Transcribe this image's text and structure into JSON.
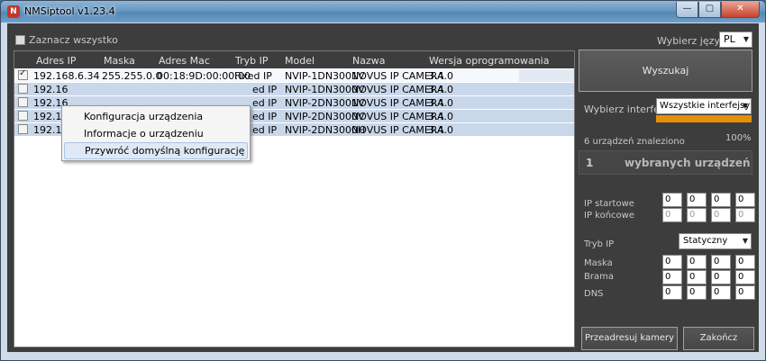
{
  "window": {
    "title": "NMSiptool v1.23.4",
    "controls": {
      "minimize": "—",
      "maximize": "▢",
      "close": "✕"
    }
  },
  "toolbar": {
    "select_all_label": "Zaznacz wszystko"
  },
  "table": {
    "columns": [
      "Adres IP",
      "Maska",
      "Adres Mac",
      "Tryb IP",
      "Model",
      "Nazwa",
      "Wersja oprogramowania"
    ],
    "rows": [
      {
        "checked": true,
        "ip": "192.168.6.34",
        "mask": "255.255.0.0",
        "mac": "00:18:9D:00:00:00",
        "mode": "Fixed IP",
        "model": "NVIP-1DN3001V",
        "name": "NOVUS IP CAMERA",
        "version": "3.4.0"
      },
      {
        "checked": false,
        "ip": "192.16",
        "mask": "",
        "mac": "",
        "mode": "ed IP",
        "model": "NVIP-1DN3000V",
        "name": "NOVUS IP CAMERA",
        "version": "3.4.0"
      },
      {
        "checked": false,
        "ip": "192.16",
        "mask": "",
        "mac": "",
        "mode": "ed IP",
        "model": "NVIP-2DN3001V",
        "name": "NOVUS IP CAMERA",
        "version": "3.4.0"
      },
      {
        "checked": false,
        "ip": "192.16",
        "mask": "",
        "mac": "",
        "mode": "ed IP",
        "model": "NVIP-2DN3000V",
        "name": "NOVUS IP CAMERA",
        "version": "3.4.0"
      },
      {
        "checked": false,
        "ip": "192.16",
        "mask": "",
        "mac": "",
        "mode": "ed IP",
        "model": "NVIP-2DN3000H",
        "name": "NOVUS IP CAMERA",
        "version": "3.4.0"
      }
    ]
  },
  "context_menu": {
    "items": [
      "Konfiguracja urządzenia",
      "Informacje o urządzeniu",
      "Przywróć domyślną konfigurację"
    ]
  },
  "panel": {
    "language_label": "Wybierz język",
    "language_value": "PL",
    "search_button": "Wyszukaj",
    "interface_label": "Wybierz interfejs",
    "interface_value": "Wszystkie interfejsy",
    "progress_percent": 100,
    "found_text": "6 urządzeń znaleziono",
    "percent_text": "100%",
    "selected_count": "1",
    "selected_label": "wybranych urządzeń",
    "ip_start_label": "IP startowe",
    "ip_end_label": "IP końcowe",
    "ip_start": [
      "0",
      "0",
      "0",
      "0"
    ],
    "ip_end": [
      "0",
      "0",
      "0",
      "0"
    ],
    "mode_label": "Tryb IP",
    "mode_value": "Statyczny",
    "mask_label": "Maska",
    "gateway_label": "Brama",
    "dns_label": "DNS",
    "mask": [
      "0",
      "0",
      "0",
      "0"
    ],
    "gateway": [
      "0",
      "0",
      "0",
      "0"
    ],
    "dns": [
      "0",
      "0",
      "0",
      "0"
    ],
    "readdress_button": "Przeadresuj kamery",
    "finish_button": "Zakończ"
  },
  "colors": {
    "accent": "#e6900a",
    "panel_bg": "#3d3d3d",
    "row_bg": "#c9d7ea"
  }
}
